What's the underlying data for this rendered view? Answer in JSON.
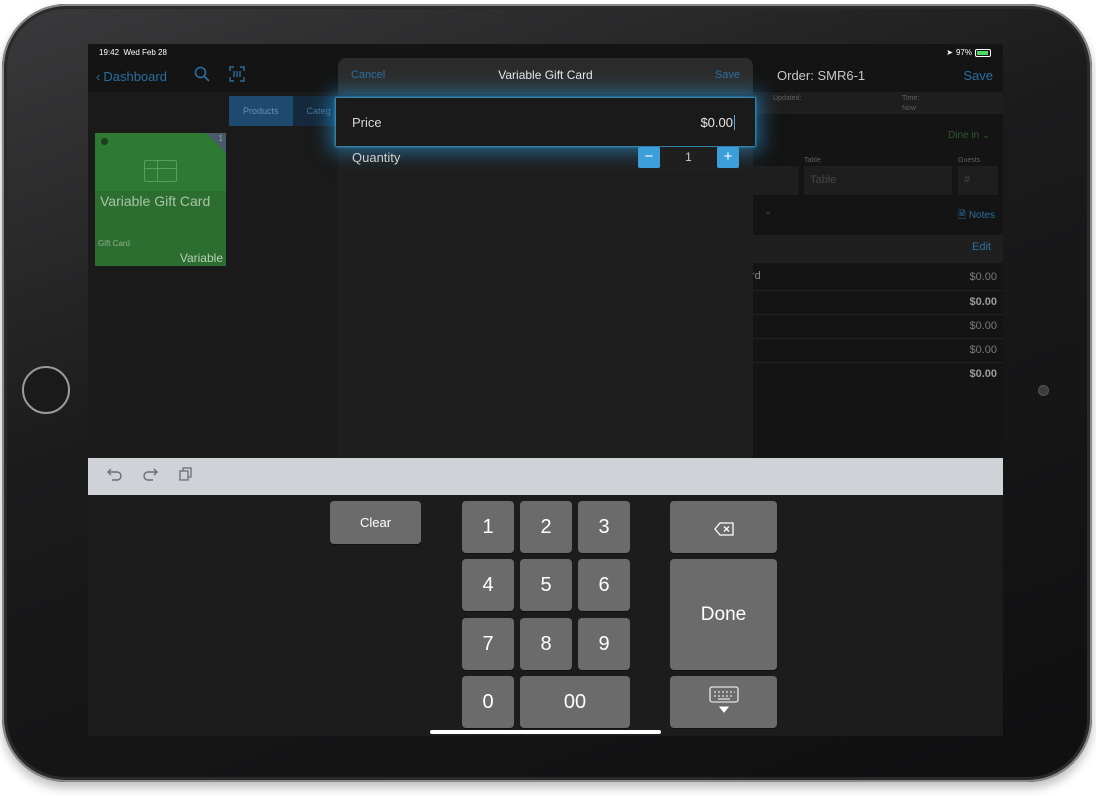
{
  "status": {
    "time": "19:42",
    "date": "Wed Feb 28",
    "battery": "97%"
  },
  "nav": {
    "back_label": "Dashboard"
  },
  "left": {
    "tabs": [
      {
        "label": "Products"
      },
      {
        "label": "Categ"
      }
    ],
    "tile": {
      "name": "Variable Gift Card",
      "type": "Gift Card",
      "variable": "Variable",
      "corner_count": "1"
    }
  },
  "order": {
    "title": "Order: SMR6-1",
    "save": "Save",
    "updated_label": "Updated:",
    "time_label": "Time:",
    "time_value": "Now",
    "dine": "Dine in",
    "table_label": "Table",
    "table_placeholder": "Table",
    "guests_label": "Guests",
    "guests_placeholder": "#",
    "notes": "Notes",
    "edit": "Edit",
    "line_item": "rd",
    "values": [
      "$0.00",
      "$0.00",
      "$0.00",
      "$0.00",
      "$0.00"
    ]
  },
  "modal": {
    "cancel": "Cancel",
    "title": "Variable Gift Card",
    "save": "Save",
    "price_label": "Price",
    "price_value": "$0.00",
    "qty_label": "Quantity",
    "qty_minus": "−",
    "qty_value": "1",
    "qty_plus": "+"
  },
  "keyboard": {
    "clear": "Clear",
    "done": "Done",
    "keys": [
      "1",
      "2",
      "3",
      "4",
      "5",
      "6",
      "7",
      "8",
      "9",
      "0",
      "00"
    ],
    "icons": {
      "undo": "undo-icon",
      "redo": "redo-icon",
      "paste": "clipboard-icon",
      "backspace": "backspace-icon",
      "dismiss": "keyboard-dismiss-icon"
    }
  }
}
